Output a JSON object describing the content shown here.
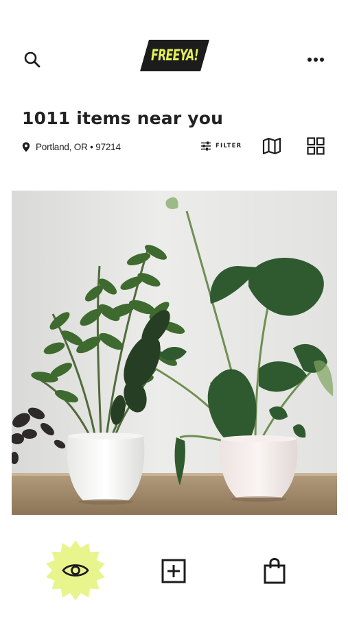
{
  "app": {
    "logo_text": "FREEYA!",
    "logo_bg": "#1c1c1c",
    "logo_fg": "#e3ef5a",
    "accent": "#e8f58c"
  },
  "header": {
    "search_icon": "search-icon",
    "more_icon": "more-horizontal-icon"
  },
  "listing": {
    "title": "1011 items near you",
    "location": "Portland, OR • 97214",
    "filter_label": "FILTER",
    "map_icon": "map-icon",
    "grid_icon": "grid-icon"
  },
  "item": {
    "image_icon": "potted-plants-photo"
  },
  "bottom_nav": {
    "items": [
      {
        "icon": "eye-icon",
        "active": true
      },
      {
        "icon": "plus-square-icon",
        "active": false
      },
      {
        "icon": "shopping-bag-icon",
        "active": false
      }
    ]
  }
}
